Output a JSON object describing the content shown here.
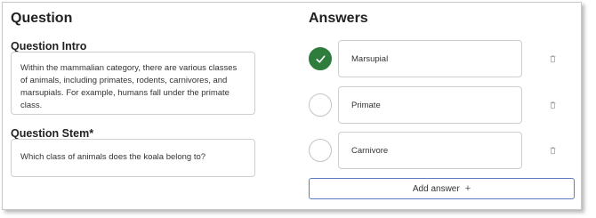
{
  "question": {
    "title": "Question",
    "intro_label": "Question Intro",
    "intro_text": "Within the mammalian category, there are various classes of animals, including primates, rodents, carnivores, and marsupials. For example, humans fall under the primate class.",
    "stem_label": "Question Stem*",
    "stem_text": "Which class of animals does the koala belong to?"
  },
  "answers": {
    "title": "Answers",
    "items": [
      {
        "label": "Marsupial",
        "correct": true
      },
      {
        "label": "Primate",
        "correct": false
      },
      {
        "label": "Carnivore",
        "correct": false
      }
    ],
    "add_label": "Add answer",
    "add_icon": "+"
  },
  "colors": {
    "correct_green": "#2f7d3c",
    "button_border": "#5a7fc0"
  },
  "icons": {
    "check": "check-icon",
    "delete": "trash-icon",
    "add": "plus-icon"
  }
}
